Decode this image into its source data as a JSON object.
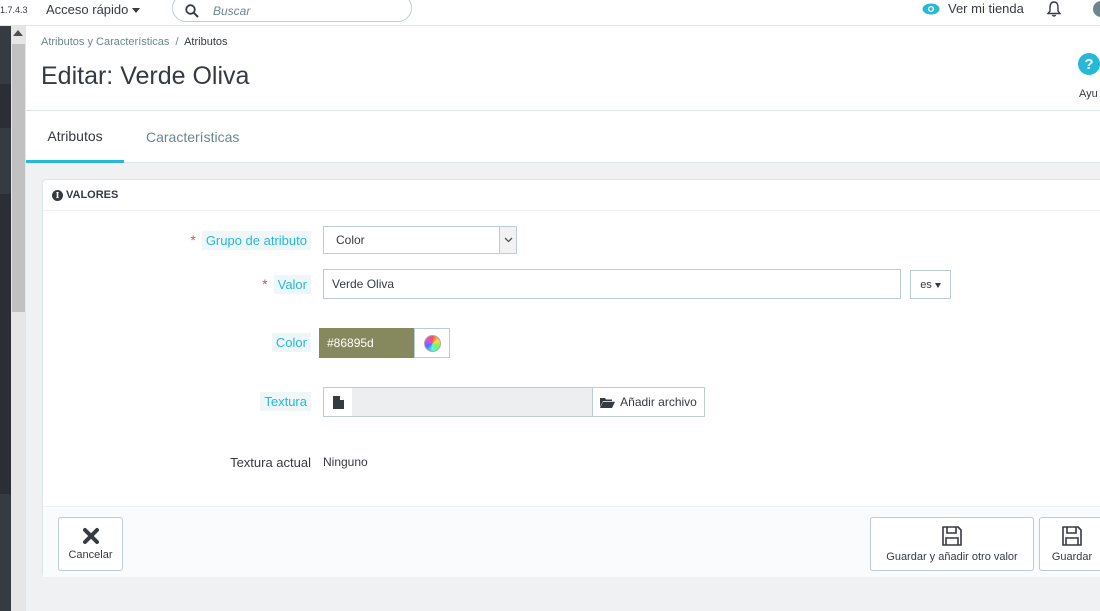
{
  "topbar": {
    "version": "1.7.4.3",
    "quick_access_label": "Acceso rápido",
    "search_placeholder": "Buscar",
    "view_store_label": "Ver mi tienda"
  },
  "breadcrumb": {
    "parent": "Atributos y Características",
    "separator": "/",
    "current": "Atributos"
  },
  "page_title": "Editar: Verde Oliva",
  "help_label": "Ayu",
  "tabs": [
    {
      "label": "Atributos",
      "active": true
    },
    {
      "label": "Características",
      "active": false
    }
  ],
  "panel": {
    "heading": "VALORES",
    "fields": {
      "attribute_group": {
        "label": "Grupo de atributo",
        "required_mark": "*",
        "value": "Color"
      },
      "value": {
        "label": "Valor",
        "required_mark": "*",
        "value": "Verde Oliva",
        "language": "es"
      },
      "color": {
        "label": "Color",
        "value": "#86895d"
      },
      "texture": {
        "label": "Textura",
        "add_file_label": "Añadir archivo"
      },
      "current_texture": {
        "label": "Textura actual",
        "value": "Ninguno"
      }
    },
    "footer": {
      "cancel_label": "Cancelar",
      "save_and_add_label": "Guardar y añadir otro valor",
      "save_label": "Guardar"
    }
  },
  "colors": {
    "accent": "#25b9d7",
    "swatch": "#86895d",
    "required": "#c05c67"
  },
  "icons": [
    "chevron-down-icon",
    "search-icon",
    "eye-icon",
    "bell-icon",
    "help-icon",
    "info-icon",
    "color-wheel-icon",
    "file-icon",
    "folder-open-icon",
    "close-icon",
    "save-icon"
  ]
}
